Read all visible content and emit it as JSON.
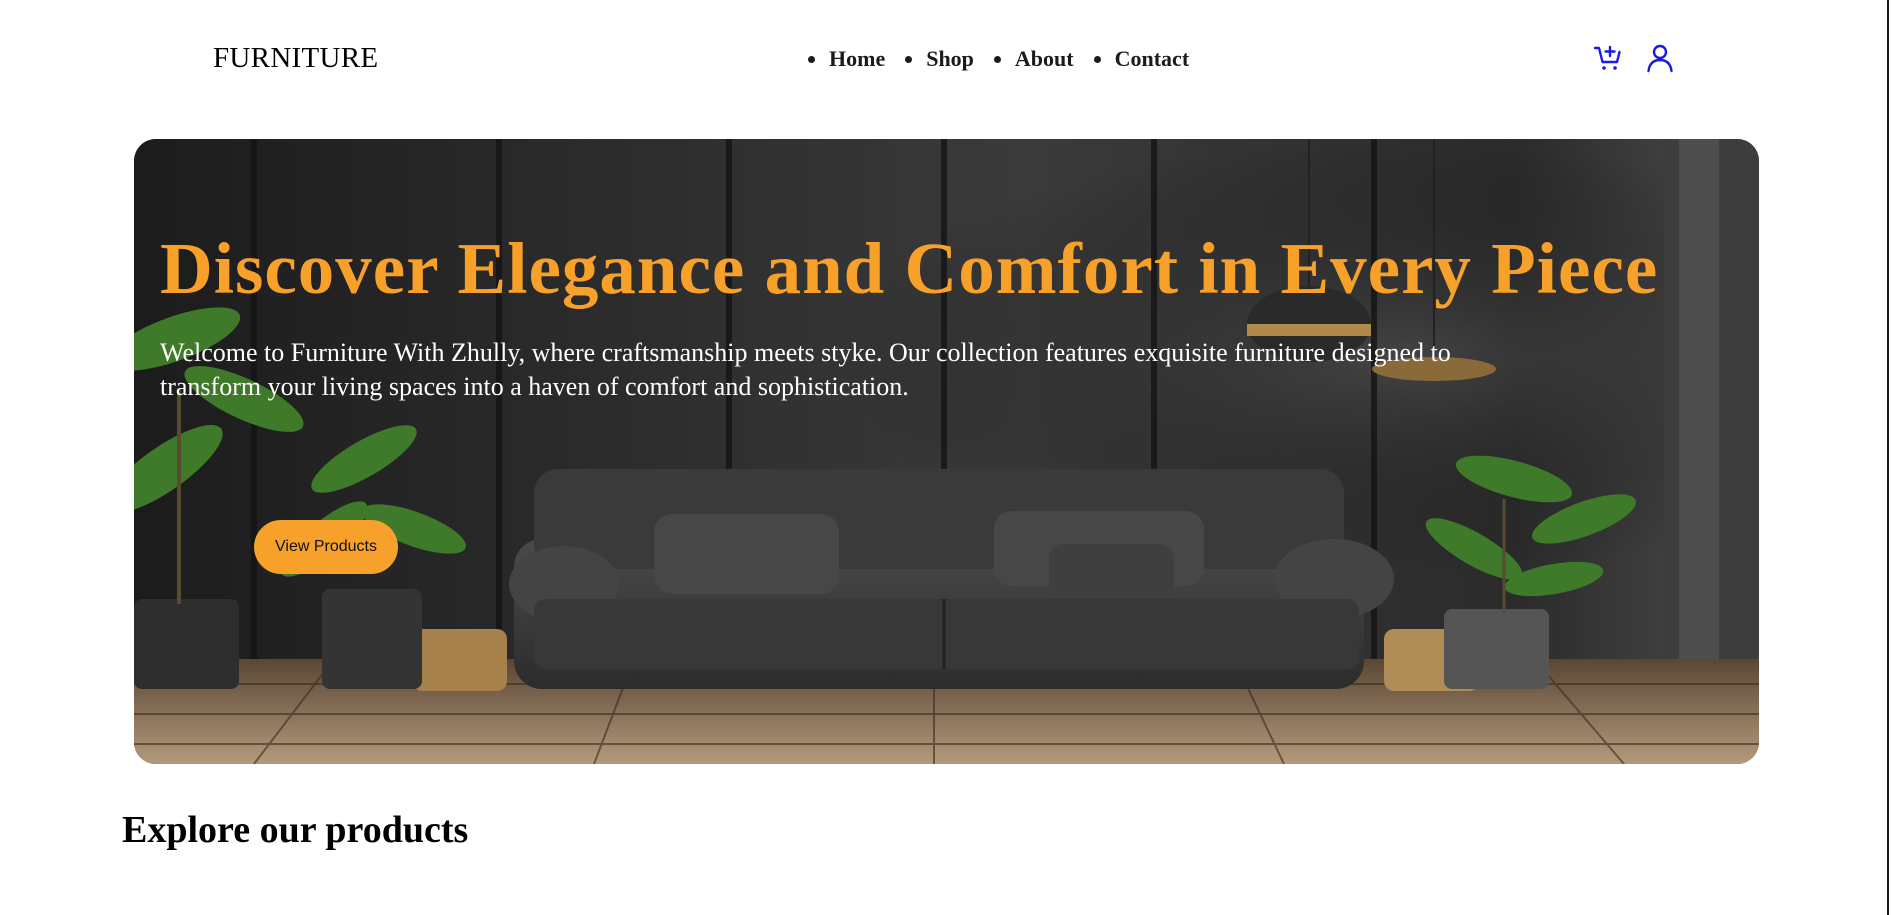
{
  "header": {
    "brand": "FURNITURE",
    "nav": [
      {
        "label": "Home"
      },
      {
        "label": "Shop"
      },
      {
        "label": "About"
      },
      {
        "label": "Contact"
      }
    ],
    "icons": [
      "cart-add-icon",
      "user-icon"
    ],
    "icon_color": "#1a1ae6"
  },
  "hero": {
    "title": "Discover Elegance and Comfort in Every Piece",
    "description": "Welcome to Furniture With Zhully, where craftsmanship meets styke. Our collection features exquisite furniture designed to transform your living spaces into a haven of comfort and sophistication.",
    "button_label": "View Products",
    "accent_color": "#f7a12a"
  },
  "sections": {
    "explore_title": "Explore our products"
  }
}
